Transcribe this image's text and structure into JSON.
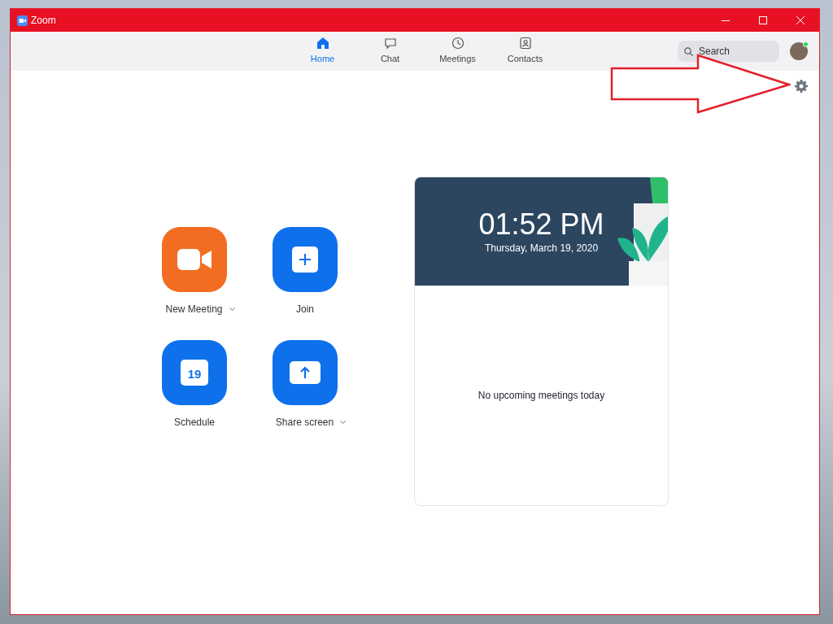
{
  "window": {
    "title": "Zoom"
  },
  "nav_tabs": [
    {
      "label": "Home",
      "kind": "home",
      "selected": true
    },
    {
      "label": "Chat",
      "kind": "chat",
      "selected": false
    },
    {
      "label": "Meetings",
      "kind": "clock",
      "selected": false
    },
    {
      "label": "Contacts",
      "kind": "contacts",
      "selected": false
    }
  ],
  "search": {
    "placeholder": "Search"
  },
  "profile": {
    "online": true
  },
  "actions": [
    {
      "label": "New Meeting",
      "kind": "video",
      "color": "#f26d21",
      "has_menu": true
    },
    {
      "label": "Join",
      "kind": "plus",
      "color": "#0e71eb",
      "has_menu": false
    },
    {
      "label": "Schedule",
      "kind": "calendar",
      "color": "#0e71eb",
      "has_menu": false,
      "calendar_day": "19"
    },
    {
      "label": "Share screen",
      "kind": "share",
      "color": "#0e71eb",
      "has_menu": true
    }
  ],
  "meetings_card": {
    "time": "01:52 PM",
    "date": "Thursday, March 19, 2020",
    "empty_message": "No upcoming meetings today"
  }
}
